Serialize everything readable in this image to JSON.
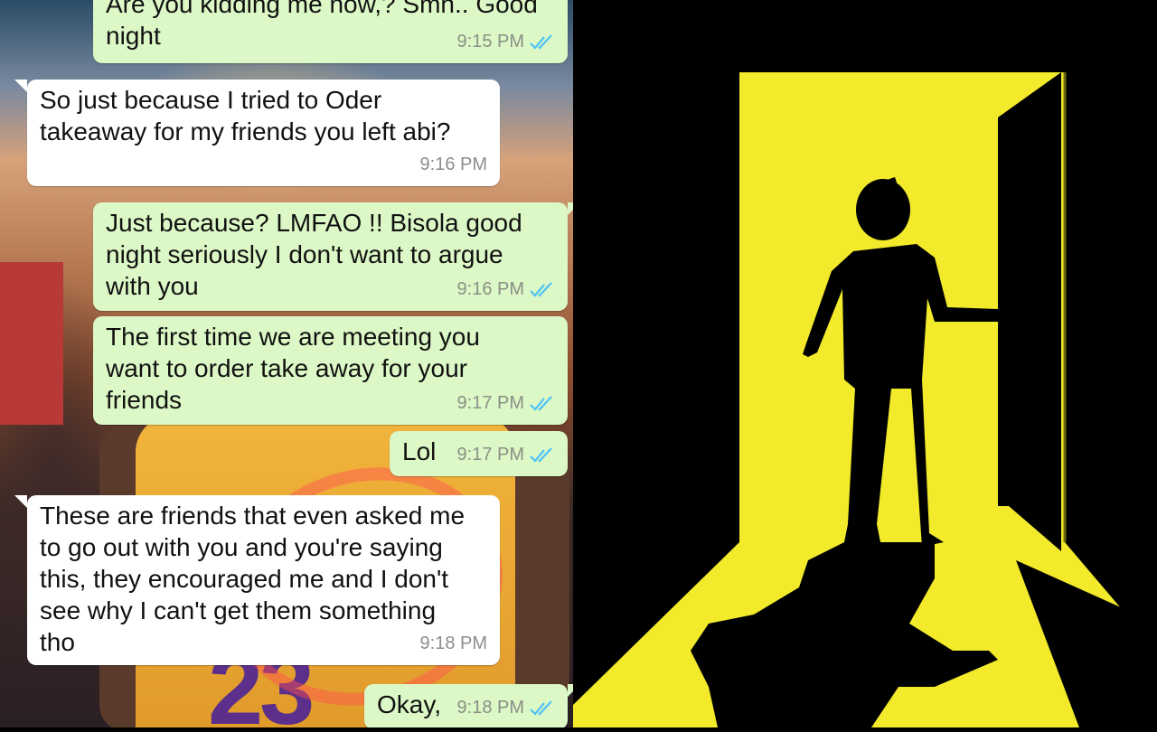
{
  "chat": {
    "messages": [
      {
        "text": "Are you kidding me now,? Smh.. Good\nnight",
        "time": "9:15 PM",
        "direction": "outgoing",
        "status": "read"
      },
      {
        "text": "So just because I tried to Oder\ntakeaway for my friends you left abi?",
        "time": "9:16 PM",
        "direction": "incoming"
      },
      {
        "text": "Just because?  LMFAO !! Bisola good\nnight  seriously I don't want to argue\nwith you",
        "time": "9:16 PM",
        "direction": "outgoing",
        "status": "read"
      },
      {
        "text": "The first time we are meeting you\nwant to order take away for your\nfriends",
        "time": "9:17 PM",
        "direction": "outgoing",
        "status": "read"
      },
      {
        "text": "Lol",
        "time": "9:17 PM",
        "direction": "outgoing",
        "status": "read"
      },
      {
        "text": "These are friends that even asked me\nto go out with you and you're saying\nthis, they encouraged me and I don't\nsee why I can't get them something\ntho",
        "time": "9:18 PM",
        "direction": "incoming"
      },
      {
        "text": "Okay,",
        "time": "9:18 PM",
        "direction": "outgoing",
        "status": "read"
      }
    ],
    "background_jersey_number": "23"
  },
  "colors": {
    "outgoing_bubble": "#dcf8c6",
    "incoming_bubble": "#ffffff",
    "read_ticks": "#4fc3f7",
    "door_light": "#f2ea2a",
    "silhouette": "#000000"
  },
  "icons": {
    "read_receipt": "double-check-icon"
  }
}
